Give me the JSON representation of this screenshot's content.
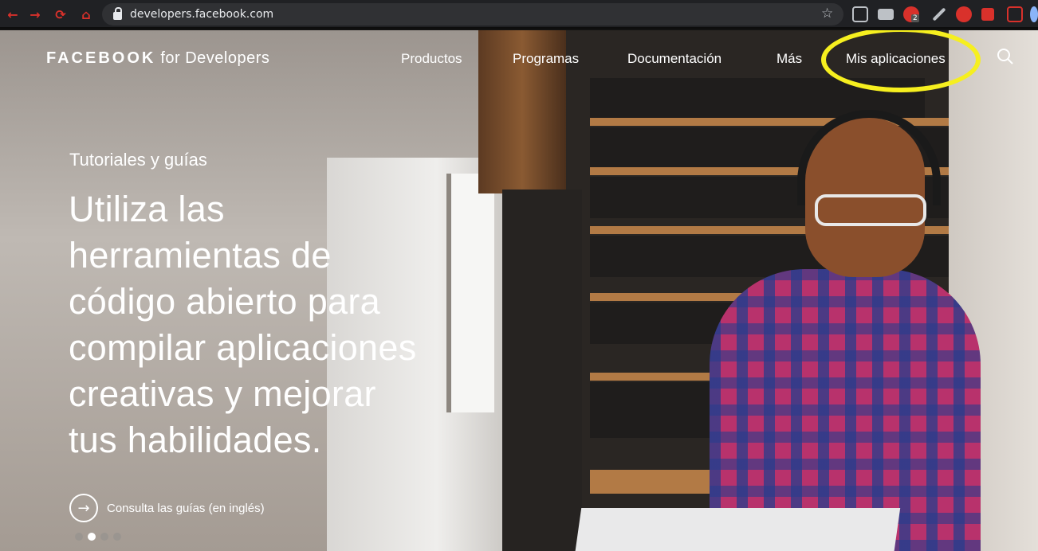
{
  "browser": {
    "url": "developers.facebook.com",
    "extension_badges": [
      "2"
    ]
  },
  "header": {
    "logo_brand": "FACEBOOK",
    "logo_sub": "for Developers",
    "nav": [
      "Productos",
      "Programas",
      "Documentación",
      "Más",
      "Mis aplicaciones"
    ]
  },
  "hero": {
    "eyebrow": "Tutoriales y guías",
    "headline_lines": [
      "Utiliza las",
      "herramientas de",
      "código abierto para",
      "compilar aplicaciones",
      "creativas y mejorar",
      "tus habilidades."
    ],
    "cta_label": "Consulta las guías (en inglés)",
    "carousel_active_index": 1,
    "carousel_count": 4
  },
  "colors": {
    "highlight": "#f6ef1f",
    "nav_icon_red": "#d9312b"
  }
}
